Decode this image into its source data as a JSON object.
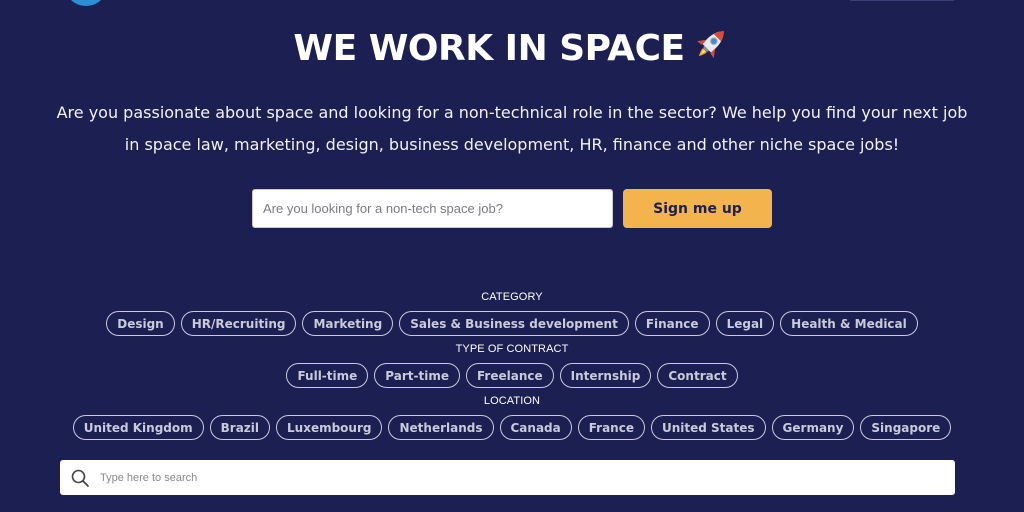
{
  "header": {
    "title": "WE WORK IN SPACE",
    "title_icon": "rocket-icon"
  },
  "intro": {
    "text": "Are you passionate about space and looking for a non-technical role in the sector? We help you find your next job in space law, marketing, design, business development, HR, finance and other niche space jobs!"
  },
  "signup": {
    "placeholder": "Are you looking for a non-tech space job?",
    "value": "",
    "button_label": "Sign me up",
    "button_color": "#f3b34d"
  },
  "filters": {
    "category": {
      "label": "CATEGORY",
      "options": [
        "Design",
        "HR/Recruiting",
        "Marketing",
        "Sales & Business development",
        "Finance",
        "Legal",
        "Health & Medical"
      ]
    },
    "contract": {
      "label": "TYPE OF CONTRACT",
      "options": [
        "Full-time",
        "Part-time",
        "Freelance",
        "Internship",
        "Contract"
      ]
    },
    "location": {
      "label": "LOCATION",
      "options": [
        "United Kingdom",
        "Brazil",
        "Luxembourg",
        "Netherlands",
        "Canada",
        "France",
        "United States",
        "Germany",
        "Singapore"
      ]
    }
  },
  "search": {
    "placeholder": "Type here to search",
    "value": "",
    "icon": "search-icon"
  },
  "colors": {
    "background": "#1b1f52",
    "accent": "#f3b34d",
    "chip_border": "#c9cbd9"
  }
}
